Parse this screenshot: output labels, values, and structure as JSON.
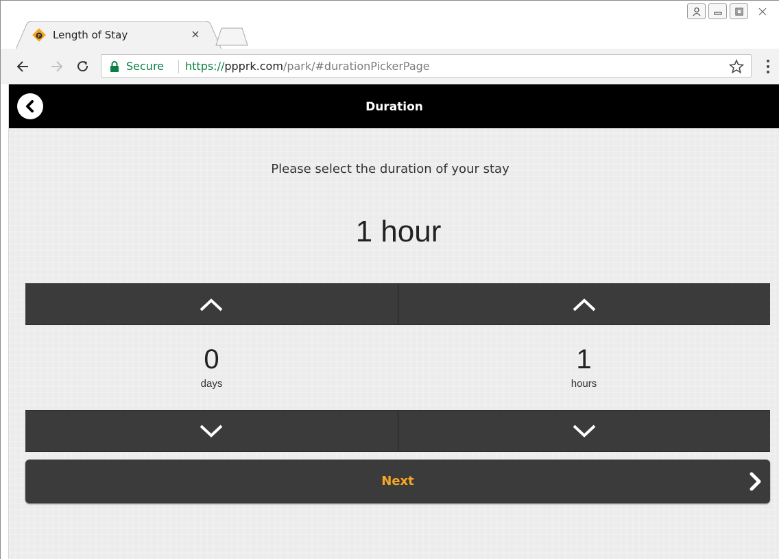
{
  "browser": {
    "tab_title": "Length of Stay",
    "tab_close": "×",
    "secure_label": "Secure",
    "url": {
      "scheme": "https://",
      "host": "ppprk.com",
      "path": "/park/#durationPickerPage"
    },
    "icons": [
      "back-arrow-icon",
      "forward-arrow-icon",
      "reload-icon",
      "lock-icon",
      "star-icon",
      "menu-icon",
      "profile-icon",
      "minimize-icon",
      "maximize-icon",
      "close-window-icon"
    ]
  },
  "header": {
    "title": "Duration",
    "back_icon": "chevron-left-circle-icon"
  },
  "main": {
    "prompt": "Please select the duration of your stay",
    "duration_display": "1 hour",
    "days": {
      "value": "0",
      "unit": "days"
    },
    "hours": {
      "value": "1",
      "unit": "hours"
    },
    "next_label": "Next",
    "colors": {
      "header_bg": "#000000",
      "button_bg": "#3b3b3b",
      "next_text": "#f7a823",
      "page_bg": "#ececec"
    }
  }
}
